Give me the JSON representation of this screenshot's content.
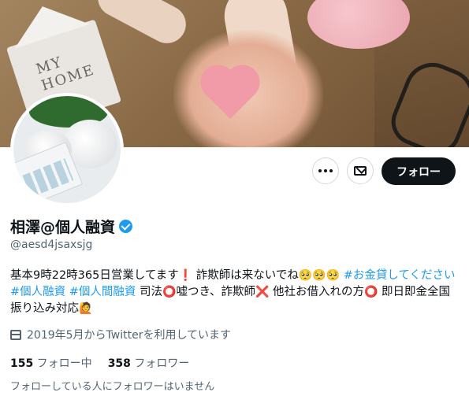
{
  "banner": {
    "image_desc": "hands holding paper heart, piggy banks, house model"
  },
  "avatar": {
    "image_desc": "piggy bank and calculator"
  },
  "actions": {
    "more_icon": "more-horizontal-icon",
    "message_icon": "envelope-icon",
    "follow_label": "フォロー"
  },
  "profile": {
    "display_name": "相澤@個人融資",
    "verified": true,
    "handle": "@aesd4jsaxsjg"
  },
  "bio": {
    "segments": [
      "基本9時22時365日営業してます",
      "❗",
      " 詐欺師は来ないでね",
      "🥺🥺🥺",
      " #お金貸してください",
      " #個人融資",
      " #個人間融資",
      " 司法",
      "⭕",
      "嘘つき、詐欺師",
      "❌",
      " 他社お借入れの方",
      "⭕",
      " 即日即金全国振り込み対応",
      "🙋"
    ]
  },
  "joined": {
    "icon": "calendar-icon",
    "text": "2019年5月からTwitterを利用しています"
  },
  "stats": {
    "following_count": "155",
    "following_label": " フォロー中",
    "followers_count": "358",
    "followers_label": " フォロワー"
  },
  "known_followers": "フォローしている人にフォロワーはいません",
  "colors": {
    "accent": "#1d9bf0",
    "text": "#0f1419",
    "muted": "#536471",
    "follow_bg": "#0f1419"
  }
}
